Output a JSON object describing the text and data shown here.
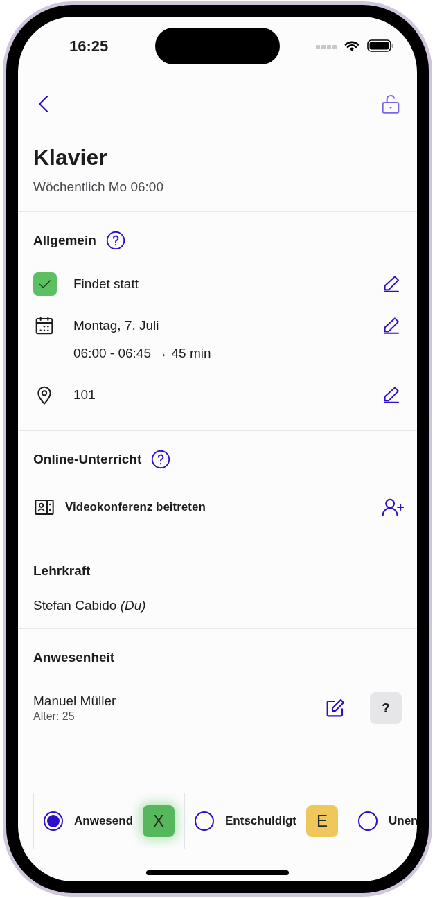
{
  "status_bar": {
    "time": "16:25"
  },
  "header": {
    "title": "Klavier",
    "subtitle": "Wöchentlich Mo 06:00"
  },
  "general": {
    "title": "Allgemein",
    "help": true,
    "rows": [
      {
        "kind": "status",
        "lines": [
          "Findet statt"
        ],
        "checked": true,
        "editable": true
      },
      {
        "kind": "date",
        "lines": [
          "Montag, 7. Juli",
          "06:00 - 06:45 → 45 min"
        ],
        "editable": true
      },
      {
        "kind": "location",
        "lines": [
          "101"
        ],
        "editable": true
      }
    ]
  },
  "online": {
    "title": "Online-Unterricht",
    "help": true,
    "link": "Videokonferenz beitreten"
  },
  "teacher": {
    "title": "Lehrkraft",
    "name": "Stefan Cabido *(Du)*"
  },
  "attendance": {
    "title": "Anwesenheit",
    "students": [
      {
        "name": "Manuel Müller",
        "age": "Alter: 25",
        "status": "?"
      }
    ]
  },
  "attendance_options": [
    {
      "label": "Anwesend",
      "selected": true,
      "badge": "X",
      "color": "#55b85c"
    },
    {
      "label": "Entschuldigt",
      "selected": false,
      "badge": "E",
      "color": "#f0c75a"
    },
    {
      "label": "Unen",
      "selected": false
    }
  ]
}
